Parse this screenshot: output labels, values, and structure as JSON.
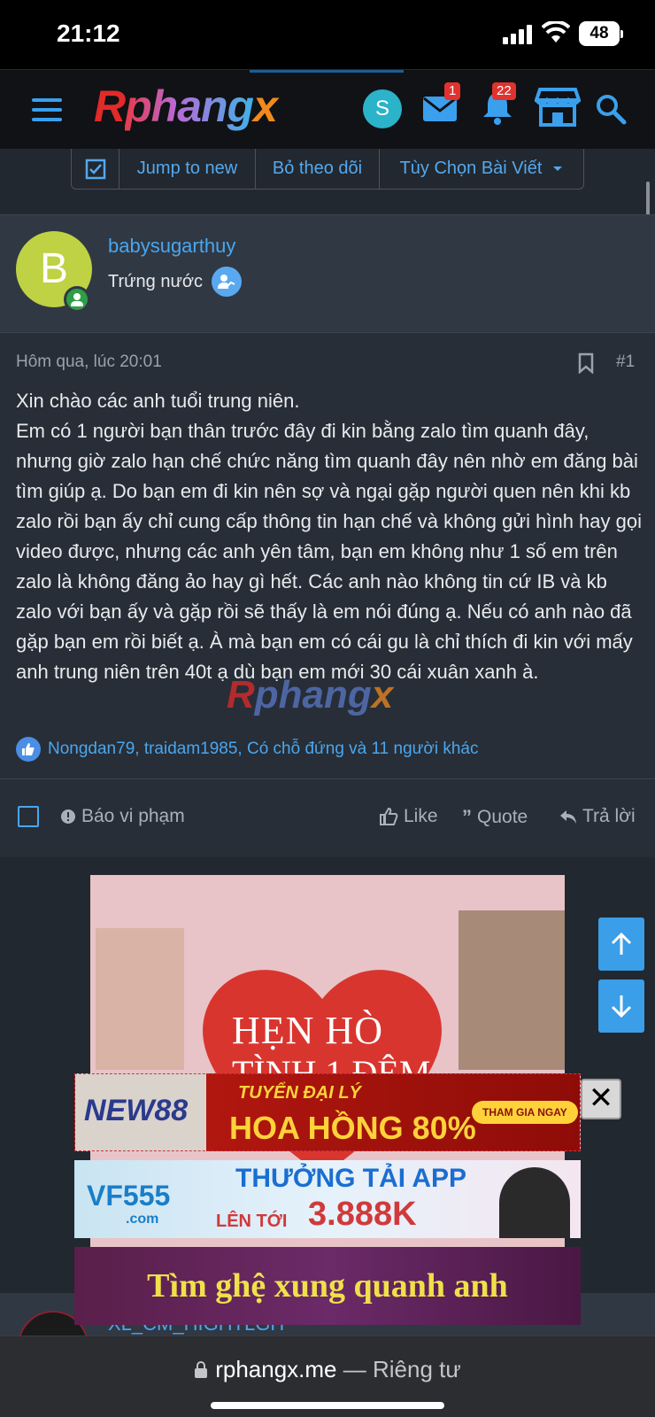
{
  "status_bar": {
    "time": "21:12",
    "battery": "48"
  },
  "header": {
    "logo": {
      "r": "R",
      "main": "phang",
      "x": "x"
    },
    "avatar_letter": "S",
    "messages_badge": "1",
    "notifications_badge": "22"
  },
  "subtoolbar": {
    "jump_label": "Jump to new",
    "unwatch_label": "Bỏ theo dõi",
    "options_label": "Tùy Chọn Bài Viết"
  },
  "post": {
    "avatar_letter": "B",
    "username": "babysugarthuy",
    "user_title": "Trứng nước",
    "date": "Hôm qua, lúc 20:01",
    "number": "#1",
    "body": [
      "Xin chào các anh tuổi trung niên.",
      "Em có 1 người bạn thân trước đây đi kin bằng zalo tìm quanh đây, nhưng giờ zalo hạn chế chức năng tìm quanh đây nên nhờ em đăng bài tìm giúp ạ. Do bạn em đi kin nên sợ và ngại gặp người quen nên khi kb zalo rồi bạn ấy chỉ cung cấp thông tin hạn chế và không gửi hình hay gọi video được, nhưng các anh yên tâm, bạn em không như 1 số em trên zalo là không đăng ảo hay gì hết. Các anh nào không tin cứ IB và kb zalo với bạn ấy và gặp rồi sẽ thấy là em nói đúng ạ. Nếu có anh nào đã gặp bạn em rồi biết ạ. À mà bạn em có cái gu là chỉ thích đi kin với mấy anh trung niên trên 40t ạ dù bạn em mới 30 cái xuân xanh à."
    ],
    "reactions_text": "Nongdan79, traidam1985, Có chỗ đứng và 11 người khác",
    "actions": {
      "report": "Báo vi phạm",
      "like": "Like",
      "quote": "Quote",
      "reply": "Trả lời"
    }
  },
  "ads": {
    "main_line1": "HẸN HÒ",
    "main_line2": "TÌNH 1 ĐÊM",
    "banner1": {
      "brand": "NEW88",
      "top": "TUYỂN ĐẠI LÝ",
      "main": "HOA HỒNG 80%",
      "cta": "THAM GIA NGAY"
    },
    "banner2": {
      "brand": "VF555",
      "sub": ".com",
      "top": "THƯỞNG TẢI APP",
      "prefix": "LÊN TỚI",
      "amount": "3.888K"
    },
    "banner3": {
      "text": "Tìm ghệ xung quanh anh"
    },
    "close": "✕"
  },
  "next_post": {
    "username": "XL_CM_HIGHTLGH"
  },
  "browser": {
    "domain": "rphangx.me",
    "suffix": " — Riêng tư"
  },
  "colors": {
    "accent": "#4aa6ee",
    "header_bg": "#101215",
    "page_bg": "#22282f"
  },
  "icons": [
    "menu-icon",
    "mail-icon",
    "bell-icon",
    "store-icon",
    "search-icon",
    "checkbox-icon",
    "dropdown-icon",
    "verified-icon",
    "bookmark-icon",
    "like-icon",
    "report-icon",
    "quote-icon",
    "reply-icon",
    "arrow-up-icon",
    "arrow-down-icon",
    "lock-icon",
    "close-icon"
  ]
}
